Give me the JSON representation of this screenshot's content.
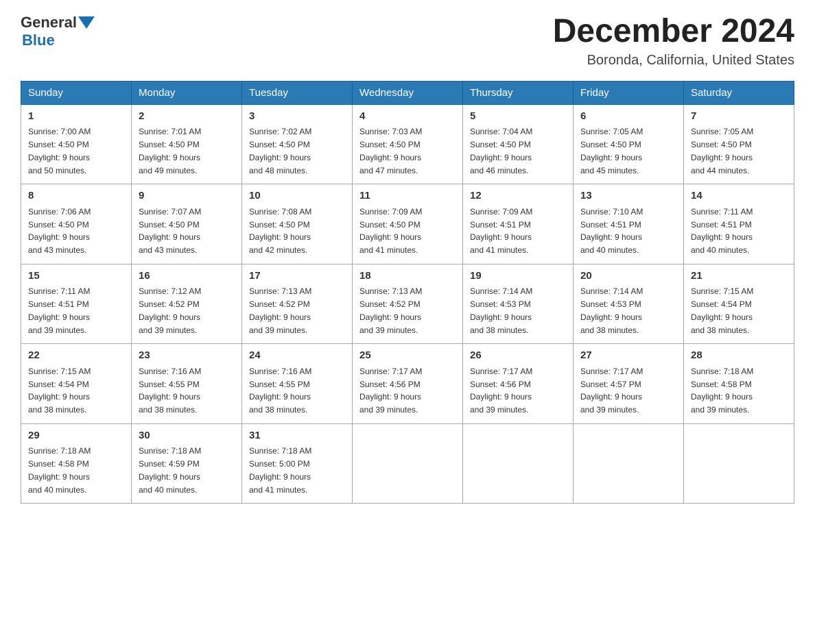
{
  "header": {
    "logo": {
      "general": "General",
      "blue": "Blue"
    },
    "title": "December 2024",
    "location": "Boronda, California, United States"
  },
  "weekdays": [
    "Sunday",
    "Monday",
    "Tuesday",
    "Wednesday",
    "Thursday",
    "Friday",
    "Saturday"
  ],
  "weeks": [
    [
      {
        "day": "1",
        "sunrise": "7:00 AM",
        "sunset": "4:50 PM",
        "daylight": "9 hours and 50 minutes."
      },
      {
        "day": "2",
        "sunrise": "7:01 AM",
        "sunset": "4:50 PM",
        "daylight": "9 hours and 49 minutes."
      },
      {
        "day": "3",
        "sunrise": "7:02 AM",
        "sunset": "4:50 PM",
        "daylight": "9 hours and 48 minutes."
      },
      {
        "day": "4",
        "sunrise": "7:03 AM",
        "sunset": "4:50 PM",
        "daylight": "9 hours and 47 minutes."
      },
      {
        "day": "5",
        "sunrise": "7:04 AM",
        "sunset": "4:50 PM",
        "daylight": "9 hours and 46 minutes."
      },
      {
        "day": "6",
        "sunrise": "7:05 AM",
        "sunset": "4:50 PM",
        "daylight": "9 hours and 45 minutes."
      },
      {
        "day": "7",
        "sunrise": "7:05 AM",
        "sunset": "4:50 PM",
        "daylight": "9 hours and 44 minutes."
      }
    ],
    [
      {
        "day": "8",
        "sunrise": "7:06 AM",
        "sunset": "4:50 PM",
        "daylight": "9 hours and 43 minutes."
      },
      {
        "day": "9",
        "sunrise": "7:07 AM",
        "sunset": "4:50 PM",
        "daylight": "9 hours and 43 minutes."
      },
      {
        "day": "10",
        "sunrise": "7:08 AM",
        "sunset": "4:50 PM",
        "daylight": "9 hours and 42 minutes."
      },
      {
        "day": "11",
        "sunrise": "7:09 AM",
        "sunset": "4:50 PM",
        "daylight": "9 hours and 41 minutes."
      },
      {
        "day": "12",
        "sunrise": "7:09 AM",
        "sunset": "4:51 PM",
        "daylight": "9 hours and 41 minutes."
      },
      {
        "day": "13",
        "sunrise": "7:10 AM",
        "sunset": "4:51 PM",
        "daylight": "9 hours and 40 minutes."
      },
      {
        "day": "14",
        "sunrise": "7:11 AM",
        "sunset": "4:51 PM",
        "daylight": "9 hours and 40 minutes."
      }
    ],
    [
      {
        "day": "15",
        "sunrise": "7:11 AM",
        "sunset": "4:51 PM",
        "daylight": "9 hours and 39 minutes."
      },
      {
        "day": "16",
        "sunrise": "7:12 AM",
        "sunset": "4:52 PM",
        "daylight": "9 hours and 39 minutes."
      },
      {
        "day": "17",
        "sunrise": "7:13 AM",
        "sunset": "4:52 PM",
        "daylight": "9 hours and 39 minutes."
      },
      {
        "day": "18",
        "sunrise": "7:13 AM",
        "sunset": "4:52 PM",
        "daylight": "9 hours and 39 minutes."
      },
      {
        "day": "19",
        "sunrise": "7:14 AM",
        "sunset": "4:53 PM",
        "daylight": "9 hours and 38 minutes."
      },
      {
        "day": "20",
        "sunrise": "7:14 AM",
        "sunset": "4:53 PM",
        "daylight": "9 hours and 38 minutes."
      },
      {
        "day": "21",
        "sunrise": "7:15 AM",
        "sunset": "4:54 PM",
        "daylight": "9 hours and 38 minutes."
      }
    ],
    [
      {
        "day": "22",
        "sunrise": "7:15 AM",
        "sunset": "4:54 PM",
        "daylight": "9 hours and 38 minutes."
      },
      {
        "day": "23",
        "sunrise": "7:16 AM",
        "sunset": "4:55 PM",
        "daylight": "9 hours and 38 minutes."
      },
      {
        "day": "24",
        "sunrise": "7:16 AM",
        "sunset": "4:55 PM",
        "daylight": "9 hours and 38 minutes."
      },
      {
        "day": "25",
        "sunrise": "7:17 AM",
        "sunset": "4:56 PM",
        "daylight": "9 hours and 39 minutes."
      },
      {
        "day": "26",
        "sunrise": "7:17 AM",
        "sunset": "4:56 PM",
        "daylight": "9 hours and 39 minutes."
      },
      {
        "day": "27",
        "sunrise": "7:17 AM",
        "sunset": "4:57 PM",
        "daylight": "9 hours and 39 minutes."
      },
      {
        "day": "28",
        "sunrise": "7:18 AM",
        "sunset": "4:58 PM",
        "daylight": "9 hours and 39 minutes."
      }
    ],
    [
      {
        "day": "29",
        "sunrise": "7:18 AM",
        "sunset": "4:58 PM",
        "daylight": "9 hours and 40 minutes."
      },
      {
        "day": "30",
        "sunrise": "7:18 AM",
        "sunset": "4:59 PM",
        "daylight": "9 hours and 40 minutes."
      },
      {
        "day": "31",
        "sunrise": "7:18 AM",
        "sunset": "5:00 PM",
        "daylight": "9 hours and 41 minutes."
      },
      null,
      null,
      null,
      null
    ]
  ],
  "labels": {
    "sunrise": "Sunrise:",
    "sunset": "Sunset:",
    "daylight": "Daylight:"
  }
}
